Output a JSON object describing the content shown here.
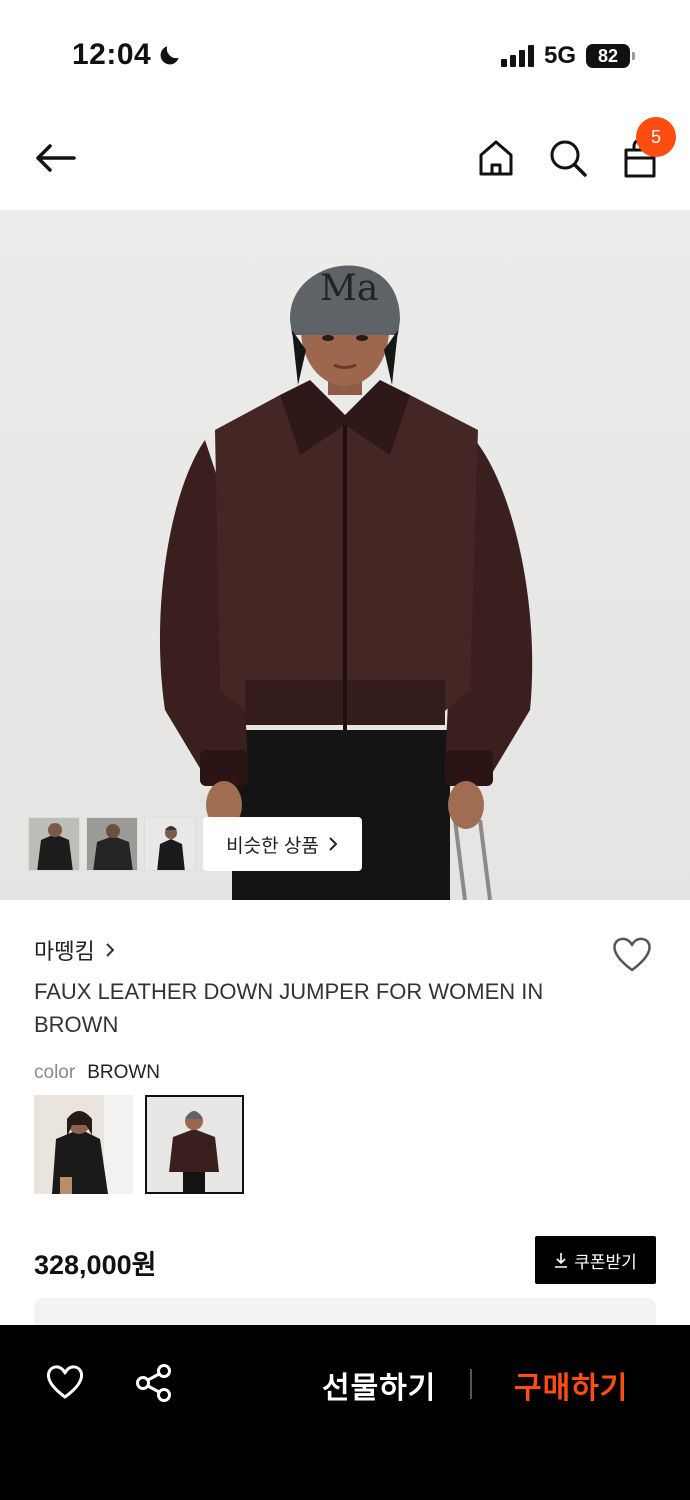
{
  "status_bar": {
    "time": "12:04",
    "network": "5G",
    "battery": "82"
  },
  "nav": {
    "cart_count": "5"
  },
  "gallery": {
    "similar_label": "비슷한 상품",
    "thumbnail_count": 3
  },
  "product": {
    "brand": "마뗑킴",
    "title": "FAUX LEATHER DOWN JUMPER FOR WOMEN IN BROWN",
    "color_label": "color",
    "color_value": "BROWN",
    "price": "328,000원",
    "coupon_label": "쿠폰받기"
  },
  "bottom_bar": {
    "gift_label": "선물하기",
    "buy_label": "구매하기"
  },
  "colors": {
    "accent": "#ff4d12",
    "jacket": "#3a1f1e",
    "bar_bg": "#000000"
  }
}
